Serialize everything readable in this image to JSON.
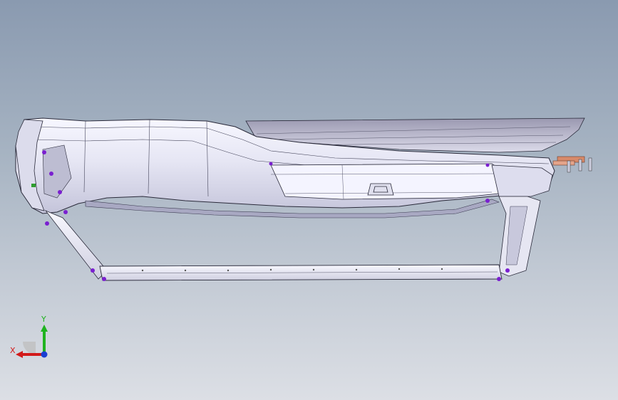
{
  "viewport": {
    "background_top": "#8a9ab0",
    "background_bottom": "#dcdfe5"
  },
  "model": {
    "body_color": "#eeeef8",
    "edge_color": "#2a2a3a",
    "highlight_color": "#ffffff",
    "shadow_color": "#b8b8d0",
    "hinge_point_color": "#7a1fd0",
    "connector_color": "#d88a6a"
  },
  "triad": {
    "x_label": "X",
    "y_label": "Y",
    "x_color": "#d21a1a",
    "y_color": "#1fb31f",
    "z_color": "#1a3fd2"
  }
}
